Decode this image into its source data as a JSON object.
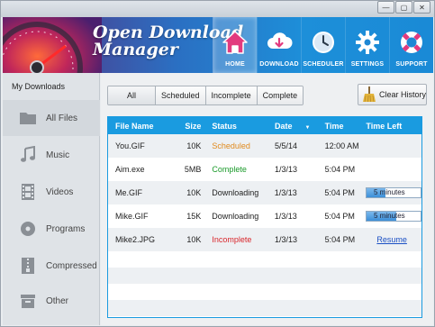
{
  "app": {
    "title_line1": "Open Download",
    "title_line2": "Manager"
  },
  "window_controls": [
    "—",
    "▢",
    "✕"
  ],
  "nav": [
    {
      "label": "HOME",
      "icon": "home-icon",
      "active": true
    },
    {
      "label": "DOWNLOAD",
      "icon": "cloud-download-icon",
      "active": false
    },
    {
      "label": "SCHEDULER",
      "icon": "clock-icon",
      "active": false
    },
    {
      "label": "SETTINGS",
      "icon": "gear-icon",
      "active": false
    },
    {
      "label": "SUPPORT",
      "icon": "lifebuoy-icon",
      "active": false
    }
  ],
  "sidebar": {
    "title": "My Downloads",
    "items": [
      {
        "label": "All Files",
        "icon": "folder-icon"
      },
      {
        "label": "Music",
        "icon": "music-note-icon"
      },
      {
        "label": "Videos",
        "icon": "film-icon"
      },
      {
        "label": "Programs",
        "icon": "disc-icon"
      },
      {
        "label": "Compressed",
        "icon": "archive-icon"
      },
      {
        "label": "Other",
        "icon": "box-icon"
      }
    ]
  },
  "filters": {
    "all": "All",
    "scheduled": "Scheduled",
    "incomplete": "Incomplete",
    "complete": "Complete"
  },
  "clear_history_label": "Clear History",
  "table": {
    "headers": {
      "file_name": "File Name",
      "size": "Size",
      "status": "Status",
      "date": "Date",
      "time": "Time",
      "time_left": "Time Left"
    },
    "rows": [
      {
        "file": "You.GIF",
        "size": "10K",
        "status": "Scheduled",
        "date": "5/5/14",
        "time": "12:00 AM",
        "time_left": ""
      },
      {
        "file": "Aim.exe",
        "size": "5MB",
        "status": "Complete",
        "date": "1/3/13",
        "time": "5:04 PM",
        "time_left": ""
      },
      {
        "file": "Me.GIF",
        "size": "10K",
        "status": "Downloading",
        "date": "1/3/13",
        "time": "5:04 PM",
        "time_left": "5 minutes",
        "progress": 0.35
      },
      {
        "file": "Mike.GIF",
        "size": "15K",
        "status": "Downloading",
        "date": "1/3/13",
        "time": "5:04 PM",
        "time_left": "5 minutes",
        "progress": 0.55
      },
      {
        "file": "Mike2.JPG",
        "size": "10K",
        "status": "Incomplete",
        "date": "1/3/13",
        "time": "5:04 PM",
        "time_left": "Resume"
      }
    ]
  },
  "colors": {
    "accent": "#1a9be0",
    "scheduled": "#e08a1e",
    "complete": "#1a9a2a",
    "incomplete": "#d9262b",
    "link": "#1a4fc4"
  }
}
